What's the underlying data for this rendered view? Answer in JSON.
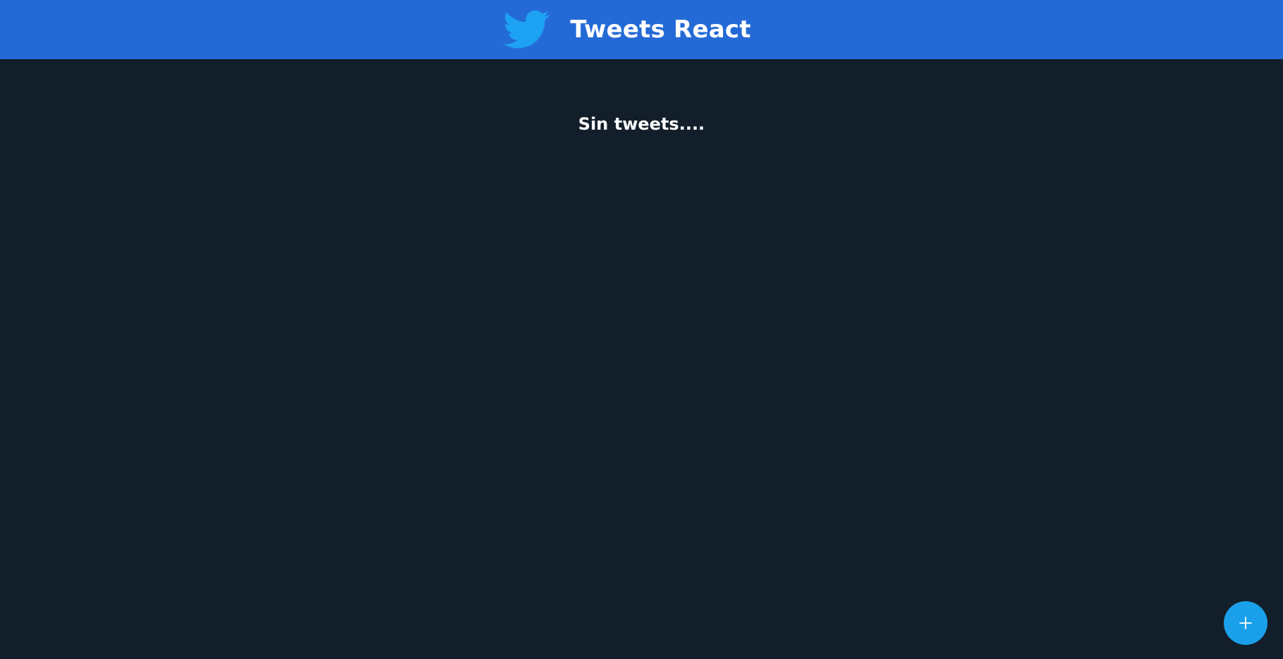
{
  "app": {
    "title": "Tweets React",
    "logo_icon": "twitter-bird-icon"
  },
  "main": {
    "empty_message": "Sin tweets...."
  },
  "fab": {
    "icon": "plus-icon"
  },
  "colors": {
    "header_bg": "#246ad6",
    "page_bg": "#131e2b",
    "accent": "#1aa0ea"
  }
}
